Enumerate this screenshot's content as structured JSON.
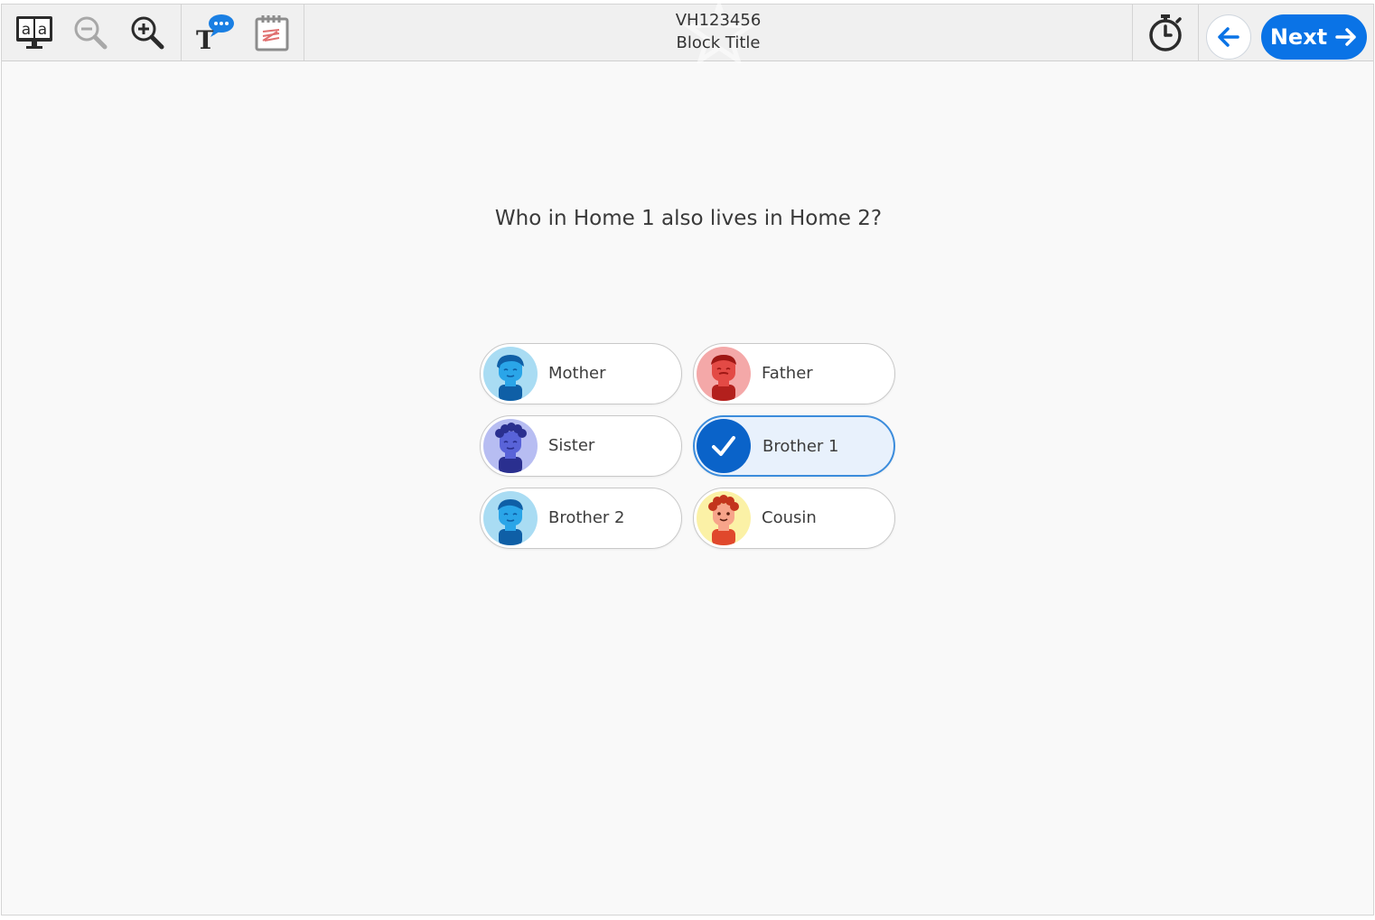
{
  "toolbar": {
    "tools_left": [
      {
        "icon": "text-to-speech-icon",
        "label": "Read aloud"
      },
      {
        "icon": "zoom-out-icon",
        "label": "Zoom out"
      },
      {
        "icon": "zoom-in-icon",
        "label": "Zoom in"
      }
    ],
    "tools_mid": [
      {
        "icon": "glossary-speech-icon",
        "label": "Glossary"
      },
      {
        "icon": "scratchpad-icon",
        "label": "Scratch pad"
      }
    ],
    "block_id": "VH123456",
    "block_title": "Block Title",
    "timer_icon": "timer-icon",
    "back_icon": "arrow-left-icon",
    "next_label": "Next",
    "next_icon": "arrow-right-icon"
  },
  "question": {
    "text": "Who in Home 1 also lives in Home 2?"
  },
  "options": [
    {
      "label": "Mother",
      "selected": false,
      "avatar": "mother-avatar-icon",
      "avatar_bg": "#a9dcf3",
      "accent": "#1b7fd2"
    },
    {
      "label": "Father",
      "selected": false,
      "avatar": "father-avatar-icon",
      "avatar_bg": "#f4a8a8",
      "accent": "#d6332f"
    },
    {
      "label": "Sister",
      "selected": false,
      "avatar": "sister-avatar-icon",
      "avatar_bg": "#b7bdf2",
      "accent": "#3a3fb3"
    },
    {
      "label": "Brother 1",
      "selected": true,
      "avatar": "check-icon",
      "avatar_bg": "#0a63c9",
      "accent": "#ffffff"
    },
    {
      "label": "Brother 2",
      "selected": false,
      "avatar": "brother-avatar-icon",
      "avatar_bg": "#a9dcf3",
      "accent": "#1b7fd2"
    },
    {
      "label": "Cousin",
      "selected": false,
      "avatar": "cousin-avatar-icon",
      "avatar_bg": "#fbf1a6",
      "accent": "#e0482c"
    }
  ],
  "colors": {
    "primary": "#0a73e6",
    "selected_border": "#3b8cdc",
    "selected_fill": "#e8f1fc",
    "toolbar_bg": "#f0f0f0",
    "page_bg": "#f9f9f9"
  }
}
